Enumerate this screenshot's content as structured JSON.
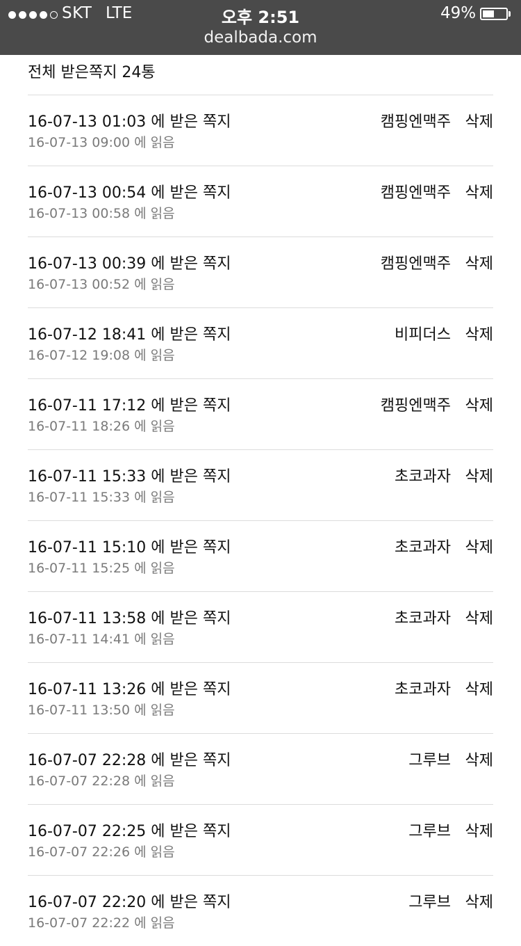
{
  "status_bar": {
    "carrier": "SKT",
    "network": "LTE",
    "time": "오후 2:51",
    "battery_percent": "49%",
    "battery_level": 0.49,
    "signal_bars_filled": 4,
    "signal_bars_total": 5
  },
  "browser": {
    "url": "dealbada.com"
  },
  "inbox": {
    "title": "전체 받은쪽지 24통",
    "messages": [
      {
        "received": "16-07-13 01:03 에 받은 쪽지",
        "read": "16-07-13 09:00 에 읽음",
        "sender": "캠핑엔맥주",
        "delete_label": "삭제"
      },
      {
        "received": "16-07-13 00:54 에 받은 쪽지",
        "read": "16-07-13 00:58 에 읽음",
        "sender": "캠핑엔맥주",
        "delete_label": "삭제"
      },
      {
        "received": "16-07-13 00:39 에 받은 쪽지",
        "read": "16-07-13 00:52 에 읽음",
        "sender": "캠핑엔맥주",
        "delete_label": "삭제"
      },
      {
        "received": "16-07-12 18:41 에 받은 쪽지",
        "read": "16-07-12 19:08 에 읽음",
        "sender": "비피더스",
        "delete_label": "삭제"
      },
      {
        "received": "16-07-11 17:12 에 받은 쪽지",
        "read": "16-07-11 18:26 에 읽음",
        "sender": "캠핑엔맥주",
        "delete_label": "삭제"
      },
      {
        "received": "16-07-11 15:33 에 받은 쪽지",
        "read": "16-07-11 15:33 에 읽음",
        "sender": "초코과자",
        "delete_label": "삭제"
      },
      {
        "received": "16-07-11 15:10 에 받은 쪽지",
        "read": "16-07-11 15:25 에 읽음",
        "sender": "초코과자",
        "delete_label": "삭제"
      },
      {
        "received": "16-07-11 13:58 에 받은 쪽지",
        "read": "16-07-11 14:41 에 읽음",
        "sender": "초코과자",
        "delete_label": "삭제"
      },
      {
        "received": "16-07-11 13:26 에 받은 쪽지",
        "read": "16-07-11 13:50 에 읽음",
        "sender": "초코과자",
        "delete_label": "삭제"
      },
      {
        "received": "16-07-07 22:28 에 받은 쪽지",
        "read": "16-07-07 22:28 에 읽음",
        "sender": "그루브",
        "delete_label": "삭제"
      },
      {
        "received": "16-07-07 22:25 에 받은 쪽지",
        "read": "16-07-07 22:26 에 읽음",
        "sender": "그루브",
        "delete_label": "삭제"
      },
      {
        "received": "16-07-07 22:20 에 받은 쪽지",
        "read": "16-07-07 22:22 에 읽음",
        "sender": "그루브",
        "delete_label": "삭제"
      }
    ]
  },
  "colors": {
    "status_bar_bg": "#4a4a4a",
    "primary_text": "#111111",
    "secondary_text": "#7a7a7a",
    "divider": "#dcdcdc"
  }
}
